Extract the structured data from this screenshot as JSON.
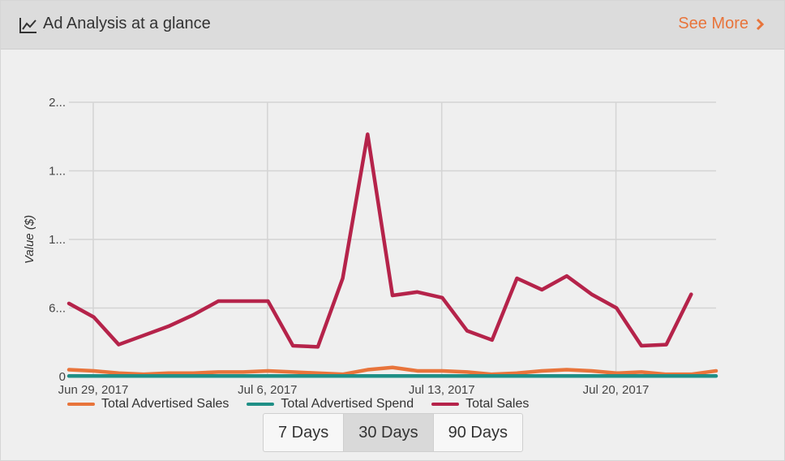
{
  "header": {
    "title": "Ad Analysis at a glance",
    "see_more_label": "See More",
    "chart_icon": "line-chart-icon",
    "chevron_icon": "chevron-right-icon"
  },
  "colors": {
    "accent": "#e8743b",
    "total_advertised_sales": "#e8743b",
    "total_advertised_spend": "#1f8f86",
    "total_sales": "#b5234a"
  },
  "range_buttons": [
    {
      "label": "7 Days",
      "active": false
    },
    {
      "label": "30 Days",
      "active": true
    },
    {
      "label": "90 Days",
      "active": false
    }
  ],
  "chart_data": {
    "type": "line",
    "ylabel": "Value ($)",
    "y_tick_labels": [
      "0",
      "6...",
      "1...",
      "1...",
      "2..."
    ],
    "y_tick_values": [
      0,
      6,
      12,
      18,
      24
    ],
    "ylim": [
      0,
      24
    ],
    "x_tick_labels": [
      "Jun 29, 2017",
      "Jul 6, 2017",
      "Jul 13, 2017",
      "Jul 20, 2017"
    ],
    "x_tick_indices": [
      0,
      7,
      14,
      21
    ],
    "grid": true,
    "legend_position": "bottom",
    "x": [
      "Jun 29",
      "Jun 30",
      "Jul 1",
      "Jul 2",
      "Jul 3",
      "Jul 4",
      "Jul 5",
      "Jul 6",
      "Jul 7",
      "Jul 8",
      "Jul 9",
      "Jul 10",
      "Jul 11",
      "Jul 12",
      "Jul 13",
      "Jul 14",
      "Jul 15",
      "Jul 16",
      "Jul 17",
      "Jul 18",
      "Jul 19",
      "Jul 20",
      "Jul 21",
      "Jul 22",
      "Jul 23",
      "Jul 24",
      "Jul 25"
    ],
    "series": [
      {
        "name": "Total Advertised Sales",
        "color": "#e8743b",
        "values": [
          0.6,
          0.5,
          0.3,
          0.2,
          0.3,
          0.3,
          0.4,
          0.4,
          0.5,
          0.4,
          0.3,
          0.2,
          0.6,
          0.8,
          0.5,
          0.5,
          0.4,
          0.2,
          0.3,
          0.5,
          0.6,
          0.5,
          0.3,
          0.4,
          0.2,
          0.2,
          0.5
        ]
      },
      {
        "name": "Total Advertised Spend",
        "color": "#1f8f86",
        "values": [
          0.05,
          0.05,
          0.05,
          0.05,
          0.05,
          0.05,
          0.05,
          0.05,
          0.05,
          0.05,
          0.05,
          0.05,
          0.05,
          0.05,
          0.05,
          0.05,
          0.05,
          0.05,
          0.05,
          0.05,
          0.05,
          0.05,
          0.05,
          0.05,
          0.05,
          0.05,
          0.05
        ]
      },
      {
        "name": "Total Sales",
        "color": "#b5234a",
        "values": [
          6.4,
          5.2,
          2.8,
          3.6,
          4.4,
          5.4,
          6.6,
          6.6,
          6.6,
          2.7,
          2.6,
          8.6,
          21.2,
          7.1,
          7.4,
          6.9,
          4.0,
          3.2,
          8.6,
          7.6,
          8.8,
          7.2,
          6.0,
          2.7,
          2.8,
          7.2
        ]
      }
    ]
  }
}
